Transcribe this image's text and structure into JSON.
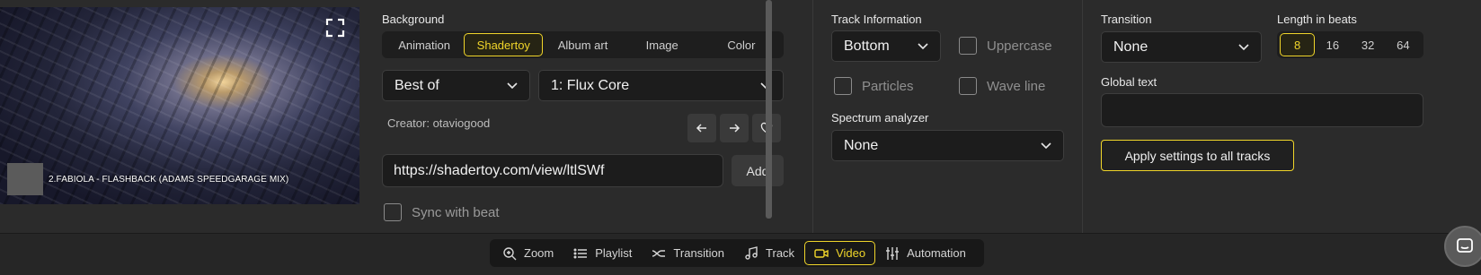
{
  "preview": {
    "track_label": "2.FABIOLA - FLASHBACK (ADAMS SPEEDGARAGE MIX)",
    "fullscreen_icon": "fullscreen-icon"
  },
  "background": {
    "label": "Background",
    "tabs": [
      {
        "label": "Animation",
        "active": false
      },
      {
        "label": "Shadertoy",
        "active": true
      },
      {
        "label": "Album art",
        "active": false
      },
      {
        "label": "Image",
        "active": false
      },
      {
        "label": "Color",
        "active": false
      }
    ],
    "category_select": "Best of",
    "shader_select": "1: Flux Core",
    "creator": "Creator: otaviogood",
    "url_value": "https://shadertoy.com/view/ltlSWf",
    "add_label": "Add",
    "sync_label": "Sync with beat"
  },
  "track_info": {
    "label": "Track Information",
    "position_select": "Bottom",
    "uppercase_label": "Uppercase",
    "particles_label": "Particles",
    "waveline_label": "Wave line",
    "spectrum_label": "Spectrum analyzer",
    "spectrum_select": "None"
  },
  "transition": {
    "label": "Transition",
    "select": "None",
    "length_label": "Length in beats",
    "beats": [
      {
        "label": "8",
        "active": true
      },
      {
        "label": "16",
        "active": false
      },
      {
        "label": "32",
        "active": false
      },
      {
        "label": "64",
        "active": false
      }
    ],
    "global_text_label": "Global text",
    "global_text_value": "",
    "apply_label": "Apply settings to all tracks"
  },
  "bottom_tabs": [
    {
      "label": "Zoom",
      "icon": "zoom-icon",
      "active": false
    },
    {
      "label": "Playlist",
      "icon": "playlist-icon",
      "active": false
    },
    {
      "label": "Transition",
      "icon": "transition-icon",
      "active": false
    },
    {
      "label": "Track",
      "icon": "music-note-icon",
      "active": false
    },
    {
      "label": "Video",
      "icon": "video-camera-icon",
      "active": true
    },
    {
      "label": "Automation",
      "icon": "sliders-icon",
      "active": false
    }
  ],
  "colors": {
    "accent": "#f0d52a",
    "background": "#2b2b2b",
    "control": "#1c1c1c"
  }
}
